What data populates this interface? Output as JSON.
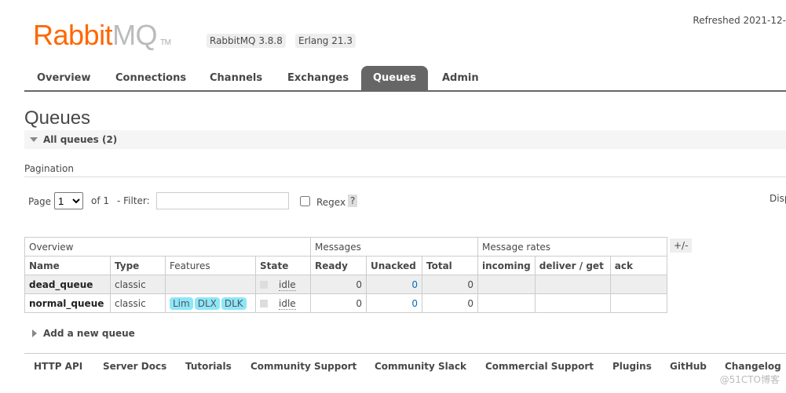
{
  "header": {
    "logo_rabbit": "Rabbit",
    "logo_mq": "MQ",
    "logo_tm": "TM",
    "version": "RabbitMQ 3.8.8",
    "erlang": "Erlang 21.3",
    "refreshed": "Refreshed 2021-12-"
  },
  "tabs": [
    {
      "label": "Overview"
    },
    {
      "label": "Connections"
    },
    {
      "label": "Channels"
    },
    {
      "label": "Exchanges"
    },
    {
      "label": "Queues",
      "active": true
    },
    {
      "label": "Admin"
    }
  ],
  "page": {
    "title": "Queues",
    "section": "All queues (2)",
    "pagination_label": "Pagination",
    "page_label": "Page",
    "page_value": "1",
    "of_label": "of 1",
    "filter_label": "- Filter:",
    "filter_value": "",
    "regex_label": "Regex",
    "regex_checked": false,
    "help": "?",
    "display_cut": "Disp",
    "toggle_columns": "+/-",
    "add_queue": "Add a new queue"
  },
  "table": {
    "groups": [
      "Overview",
      "Messages",
      "Message rates"
    ],
    "columns": [
      "Name",
      "Type",
      "Features",
      "State",
      "Ready",
      "Unacked",
      "Total",
      "incoming",
      "deliver / get",
      "ack"
    ],
    "rows": [
      {
        "name": "dead_queue",
        "type": "classic",
        "features": [],
        "state": "idle",
        "ready": "0",
        "unacked": "0",
        "total": "0"
      },
      {
        "name": "normal_queue",
        "type": "classic",
        "features": [
          "Lim",
          "DLX",
          "DLK"
        ],
        "state": "idle",
        "ready": "0",
        "unacked": "0",
        "total": "0"
      }
    ]
  },
  "footer": [
    "HTTP API",
    "Server Docs",
    "Tutorials",
    "Community Support",
    "Community Slack",
    "Commercial Support",
    "Plugins",
    "GitHub",
    "Changelog"
  ],
  "watermark": "@51CTO博客",
  "colors": {
    "brand": "#ff6600",
    "active_tab": "#666666",
    "badge": "#8ee6f9"
  }
}
